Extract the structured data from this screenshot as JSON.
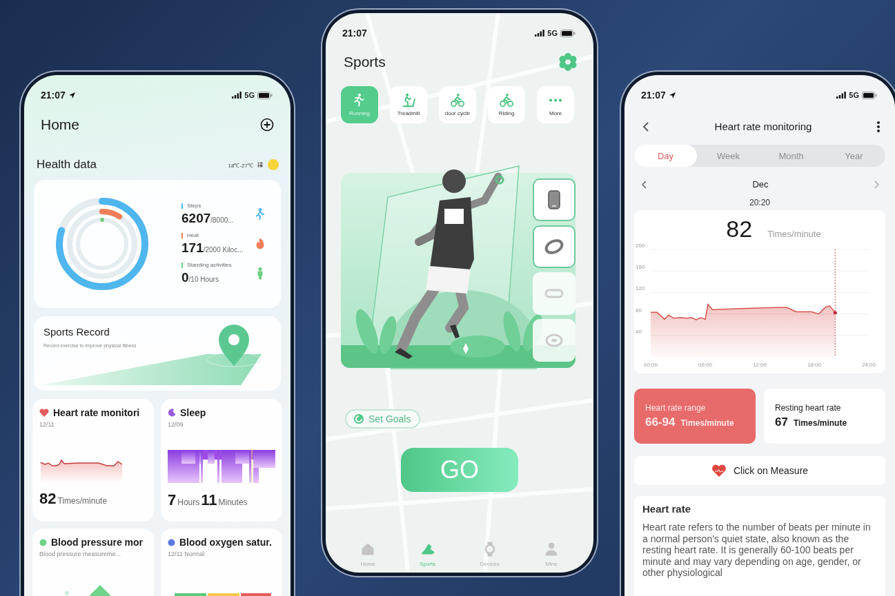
{
  "home_screen": {
    "status_bar": {
      "time": "21:07",
      "location": true,
      "network": "5G"
    },
    "title": "Home",
    "section_title": "Health data",
    "weather": "18℃-27℃",
    "metrics": [
      {
        "kind": "steps",
        "label": "Steps",
        "value": "6207",
        "goal": "/8000...",
        "level": 0.8,
        "color": "#4fb6ee"
      },
      {
        "kind": "heat",
        "label": "Heat",
        "value": "171",
        "goal": "/2000 Kiloc...",
        "level": 0.09,
        "color": "#ef7d57"
      },
      {
        "kind": "standing",
        "label": "Standing activities",
        "value": "0",
        "goal": "/10 Hours",
        "level": 0,
        "color": "#6fcf7f"
      }
    ],
    "sports_record": {
      "title": "Sports Record",
      "subtitle": "Record exercise to improve physical fitness"
    },
    "cards": [
      {
        "kind": "heart",
        "color": "#e35b5b",
        "title": "Heart rate monitori",
        "date": "12/11",
        "value": "82",
        "unit": "Times/minute"
      },
      {
        "kind": "sleep",
        "color": "#9a5ae0",
        "title": "Sleep",
        "date": "12/09",
        "hours": "7",
        "hours_unit": "Hours",
        "minutes": "11",
        "minutes_unit": "Minutes"
      },
      {
        "kind": "blood_pressure",
        "color": "#6fd38a",
        "title": "Blood pressure mor",
        "date": "Blood pressure measureme..."
      },
      {
        "kind": "blood_oxygen",
        "color": "#5a78e0",
        "title": "Blood oxygen satur.",
        "date": "12/11 Normal"
      }
    ]
  },
  "sports_screen": {
    "status_bar": {
      "time": "21:07",
      "location": false,
      "network": "5G"
    },
    "title": "Sports",
    "sport_types": [
      {
        "kind": "running",
        "label": "Running",
        "selected": true
      },
      {
        "kind": "treadmill",
        "label": "Treadmill",
        "selected": false
      },
      {
        "kind": "cycling",
        "label": "door cyclir",
        "selected": false
      },
      {
        "kind": "cycling",
        "label": "Riding",
        "selected": false
      },
      {
        "kind": "more",
        "label": "More",
        "selected": false
      }
    ],
    "devices": [
      {
        "kind": "phone",
        "selected": true
      },
      {
        "kind": "ring",
        "selected": true
      },
      {
        "kind": "band",
        "selected": false
      },
      {
        "kind": "watch",
        "selected": false
      }
    ],
    "set_goals": "Set Goals",
    "go": "GO",
    "nav": [
      {
        "kind": "home",
        "label": "Home",
        "selected": false
      },
      {
        "kind": "sports",
        "label": "Sports",
        "selected": true
      },
      {
        "kind": "devices",
        "label": "Devices",
        "selected": false
      },
      {
        "kind": "mine",
        "label": "Mine",
        "selected": false
      }
    ]
  },
  "heart_rate_screen": {
    "status_bar": {
      "time": "21:07",
      "location": true,
      "network": "5G"
    },
    "title": "Heart rate monitoring",
    "periods": [
      {
        "label": "Day",
        "selected": true
      },
      {
        "label": "Week",
        "selected": false
      },
      {
        "label": "Month",
        "selected": false
      },
      {
        "label": "Year",
        "selected": false
      }
    ],
    "month": "Dec",
    "time": "20:20",
    "value": "82",
    "unit": "Times/minute",
    "chart_data": {
      "type": "area",
      "x": [
        0,
        0.7,
        1.5,
        2,
        2.5,
        3.3,
        4,
        4.5,
        5,
        5.5,
        6,
        6.3,
        6.8,
        10,
        14,
        15,
        16,
        17,
        17.7,
        18.5,
        19.2,
        19.7,
        20.3
      ],
      "series": [
        {
          "color": "#d9534f",
          "values": [
            83,
            83,
            70,
            78,
            72,
            73,
            72,
            73,
            69,
            73,
            70,
            98,
            88,
            90,
            92,
            92,
            84,
            84,
            84,
            80,
            92,
            95,
            82
          ]
        }
      ],
      "xlim": [
        0,
        24
      ],
      "ylim": [
        0,
        200
      ],
      "grid": true,
      "ref_lines": [
        {
          "axis": "x",
          "value": 20.3
        }
      ],
      "xticks": [
        {
          "value": 0,
          "label": "00:00"
        },
        {
          "value": 6,
          "label": "06:00"
        },
        {
          "value": 12,
          "label": "12:00"
        },
        {
          "value": 18,
          "label": "18:00"
        },
        {
          "value": 24,
          "label": "24:00"
        }
      ],
      "yticks": [
        40,
        80,
        120,
        160,
        200
      ]
    },
    "range": {
      "label": "Heart rate range",
      "value": "66-94",
      "unit": "Times/minute"
    },
    "resting": {
      "label": "Resting heart rate",
      "value": "67",
      "unit": "Times/minute"
    },
    "measure": "Click on Measure",
    "info": {
      "title": "Heart rate",
      "text": "Heart rate refers to the number of beats per minute in a normal person's quiet state, also known as the resting heart rate. It is generally 60-100 beats per minute and may vary depending on age, gender, or other physiological"
    }
  }
}
